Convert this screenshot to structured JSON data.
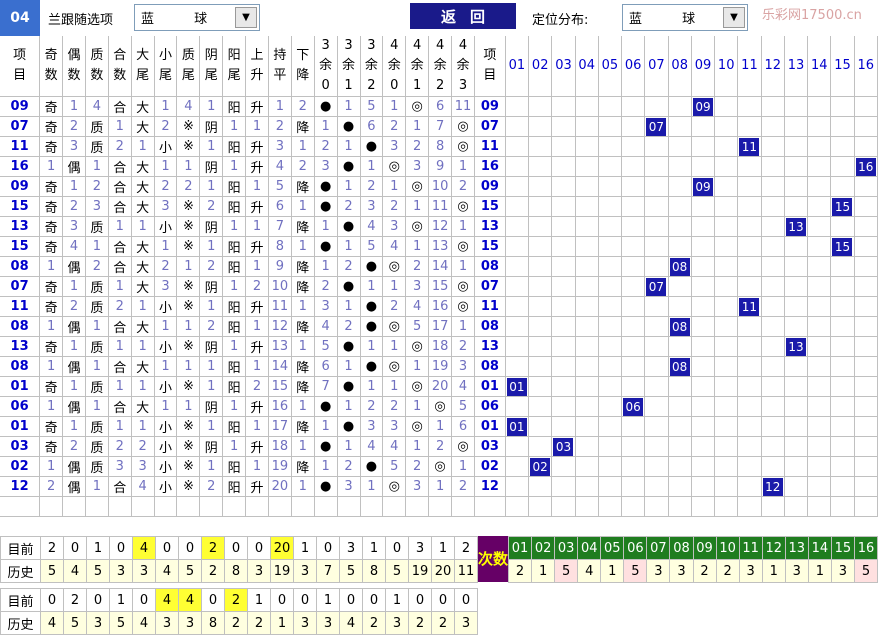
{
  "topbar": {
    "code": "04",
    "filter_label": "兰跟随选项",
    "filter_value": "蓝  球",
    "back_label": "返回",
    "dist_label": "定位分布:",
    "dist_value": "蓝  球",
    "watermark": "乐彩网17500.cn"
  },
  "headers": [
    "项目",
    "奇数",
    "偶数",
    "质数",
    "合数",
    "大尾",
    "小尾",
    "质尾",
    "阴尾",
    "阳尾",
    "上升",
    "持平",
    "下降",
    "3余0",
    "3余1",
    "3余2",
    "4余0",
    "4余1",
    "4余2",
    "4余3",
    "项目"
  ],
  "ball_headers": [
    "01",
    "02",
    "03",
    "04",
    "05",
    "06",
    "07",
    "08",
    "09",
    "10",
    "11",
    "12",
    "13",
    "14",
    "15",
    "16"
  ],
  "rows": [
    {
      "no": "09",
      "c": [
        "奇",
        "1",
        "4",
        "合",
        "大",
        "1",
        "4",
        "1",
        "阳",
        "升",
        "1",
        "2",
        "●",
        "1",
        "5",
        "1",
        "◎",
        "6",
        "11"
      ]
    },
    {
      "no": "07",
      "c": [
        "奇",
        "2",
        "质",
        "1",
        "大",
        "2",
        "※",
        "阴",
        "1",
        "1",
        "2",
        "降",
        "1",
        "●",
        "6",
        "2",
        "1",
        "7",
        "◎"
      ]
    },
    {
      "no": "11",
      "c": [
        "奇",
        "3",
        "质",
        "2",
        "1",
        "小",
        "※",
        "1",
        "阳",
        "升",
        "3",
        "1",
        "2",
        "1",
        "●",
        "3",
        "2",
        "8",
        "◎"
      ]
    },
    {
      "no": "16",
      "c": [
        "1",
        "偶",
        "1",
        "合",
        "大",
        "1",
        "1",
        "阴",
        "1",
        "升",
        "4",
        "2",
        "3",
        "●",
        "1",
        "◎",
        "3",
        "9",
        "1"
      ]
    },
    {
      "no": "09",
      "c": [
        "奇",
        "1",
        "2",
        "合",
        "大",
        "2",
        "2",
        "1",
        "阳",
        "1",
        "5",
        "降",
        "●",
        "1",
        "2",
        "1",
        "◎",
        "10",
        "2"
      ]
    },
    {
      "no": "15",
      "c": [
        "奇",
        "2",
        "3",
        "合",
        "大",
        "3",
        "※",
        "2",
        "阳",
        "升",
        "6",
        "1",
        "●",
        "2",
        "3",
        "2",
        "1",
        "11",
        "◎"
      ]
    },
    {
      "no": "13",
      "c": [
        "奇",
        "3",
        "质",
        "1",
        "1",
        "小",
        "※",
        "阴",
        "1",
        "1",
        "7",
        "降",
        "1",
        "●",
        "4",
        "3",
        "◎",
        "12",
        "1"
      ]
    },
    {
      "no": "15",
      "c": [
        "奇",
        "4",
        "1",
        "合",
        "大",
        "1",
        "※",
        "1",
        "阳",
        "升",
        "8",
        "1",
        "●",
        "1",
        "5",
        "4",
        "1",
        "13",
        "◎"
      ]
    },
    {
      "no": "08",
      "c": [
        "1",
        "偶",
        "2",
        "合",
        "大",
        "2",
        "1",
        "2",
        "阳",
        "1",
        "9",
        "降",
        "1",
        "2",
        "●",
        "◎",
        "2",
        "14",
        "1"
      ]
    },
    {
      "no": "07",
      "c": [
        "奇",
        "1",
        "质",
        "1",
        "大",
        "3",
        "※",
        "阴",
        "1",
        "2",
        "10",
        "降",
        "2",
        "●",
        "1",
        "1",
        "3",
        "15",
        "◎"
      ]
    },
    {
      "no": "11",
      "c": [
        "奇",
        "2",
        "质",
        "2",
        "1",
        "小",
        "※",
        "1",
        "阳",
        "升",
        "11",
        "1",
        "3",
        "1",
        "●",
        "2",
        "4",
        "16",
        "◎"
      ]
    },
    {
      "no": "08",
      "c": [
        "1",
        "偶",
        "1",
        "合",
        "大",
        "1",
        "1",
        "2",
        "阳",
        "1",
        "12",
        "降",
        "4",
        "2",
        "●",
        "◎",
        "5",
        "17",
        "1"
      ]
    },
    {
      "no": "13",
      "c": [
        "奇",
        "1",
        "质",
        "1",
        "1",
        "小",
        "※",
        "阴",
        "1",
        "升",
        "13",
        "1",
        "5",
        "●",
        "1",
        "1",
        "◎",
        "18",
        "2"
      ]
    },
    {
      "no": "08",
      "c": [
        "1",
        "偶",
        "1",
        "合",
        "大",
        "1",
        "1",
        "1",
        "阳",
        "1",
        "14",
        "降",
        "6",
        "1",
        "●",
        "◎",
        "1",
        "19",
        "3"
      ]
    },
    {
      "no": "01",
      "c": [
        "奇",
        "1",
        "质",
        "1",
        "1",
        "小",
        "※",
        "1",
        "阳",
        "2",
        "15",
        "降",
        "7",
        "●",
        "1",
        "1",
        "◎",
        "20",
        "4"
      ]
    },
    {
      "no": "06",
      "c": [
        "1",
        "偶",
        "1",
        "合",
        "大",
        "1",
        "1",
        "阴",
        "1",
        "升",
        "16",
        "1",
        "●",
        "1",
        "2",
        "2",
        "1",
        "◎",
        "5"
      ]
    },
    {
      "no": "01",
      "c": [
        "奇",
        "1",
        "质",
        "1",
        "1",
        "小",
        "※",
        "1",
        "阳",
        "1",
        "17",
        "降",
        "1",
        "●",
        "3",
        "3",
        "◎",
        "1",
        "6"
      ]
    },
    {
      "no": "03",
      "c": [
        "奇",
        "2",
        "质",
        "2",
        "2",
        "小",
        "※",
        "阴",
        "1",
        "升",
        "18",
        "1",
        "●",
        "1",
        "4",
        "4",
        "1",
        "2",
        "◎"
      ]
    },
    {
      "no": "02",
      "c": [
        "1",
        "偶",
        "质",
        "3",
        "3",
        "小",
        "※",
        "1",
        "阳",
        "1",
        "19",
        "降",
        "1",
        "2",
        "●",
        "5",
        "2",
        "◎",
        "1"
      ]
    },
    {
      "no": "12",
      "c": [
        "2",
        "偶",
        "1",
        "合",
        "4",
        "小",
        "※",
        "2",
        "阳",
        "升",
        "20",
        "1",
        "●",
        "3",
        "1",
        "◎",
        "3",
        "1",
        "2"
      ]
    }
  ],
  "ball_positions": [
    9,
    7,
    11,
    16,
    9,
    15,
    13,
    15,
    8,
    7,
    11,
    8,
    13,
    8,
    1,
    6,
    1,
    3,
    2,
    12
  ],
  "stats1": {
    "now_label": "目前",
    "hist_label": "历史",
    "now": [
      "2",
      "0",
      "1",
      "0",
      "4",
      "0",
      "0",
      "2",
      "0",
      "0",
      "20",
      "1",
      "0",
      "3",
      "1",
      "0",
      "3",
      "1",
      "2"
    ],
    "hist": [
      "5",
      "4",
      "5",
      "3",
      "3",
      "4",
      "5",
      "2",
      "8",
      "3",
      "19",
      "3",
      "7",
      "5",
      "8",
      "5",
      "19",
      "20",
      "11"
    ]
  },
  "cishu_label": "次数",
  "ball_counts": [
    "2",
    "1",
    "5",
    "4",
    "1",
    "5",
    "3",
    "3",
    "2",
    "2",
    "3",
    "1",
    "3",
    "1",
    "3",
    "5"
  ],
  "stats2": {
    "now_label": "目前",
    "hist_label": "历史",
    "now": [
      "0",
      "2",
      "0",
      "1",
      "0",
      "4",
      "4",
      "0",
      "2",
      "1",
      "0",
      "0",
      "1",
      "0",
      "0",
      "1",
      "0",
      "0",
      "0"
    ],
    "hist": [
      "4",
      "5",
      "3",
      "5",
      "4",
      "3",
      "3",
      "8",
      "2",
      "2",
      "1",
      "3",
      "3",
      "4",
      "2",
      "3",
      "2",
      "2",
      "3"
    ]
  }
}
